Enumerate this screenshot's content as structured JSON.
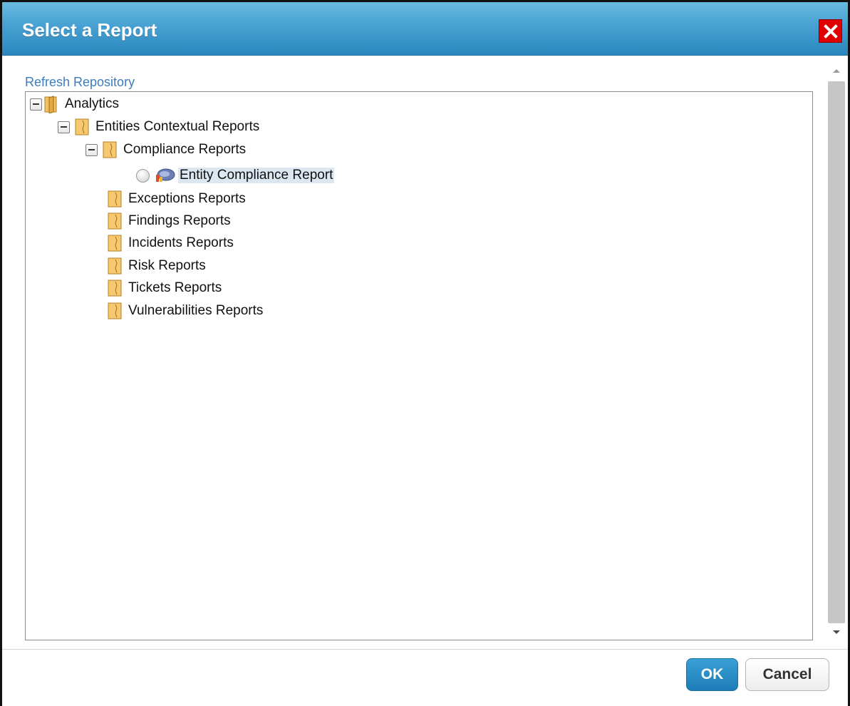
{
  "dialog": {
    "title": "Select a Report",
    "close_icon": "close-x-icon",
    "accent_color": "#2a86bd",
    "close_color": "#e00000"
  },
  "repository": {
    "refresh_label": "Refresh Repository"
  },
  "tree": {
    "root": {
      "label": "Analytics",
      "expanded": true,
      "icon": "folder-open-icon"
    },
    "entities": {
      "label": "Entities Contextual Reports",
      "expanded": true,
      "icon": "folder-icon"
    },
    "compliance": {
      "label": "Compliance Reports",
      "expanded": true,
      "icon": "folder-icon"
    },
    "entity_compliance": {
      "label": "Entity Compliance Report",
      "icon": "report-icon",
      "selected": false
    },
    "folders": [
      {
        "label": "Exceptions Reports"
      },
      {
        "label": "Findings Reports"
      },
      {
        "label": "Incidents Reports"
      },
      {
        "label": "Risk Reports"
      },
      {
        "label": "Tickets Reports"
      },
      {
        "label": "Vulnerabilities Reports"
      }
    ]
  },
  "footer": {
    "ok_label": "OK",
    "cancel_label": "Cancel"
  }
}
